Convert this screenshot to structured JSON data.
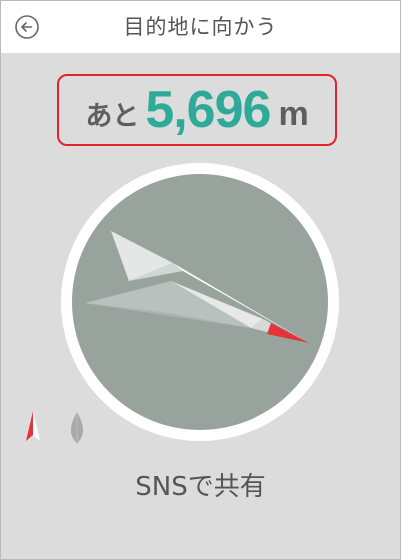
{
  "header": {
    "title": "目的地に向かう",
    "back_icon": "back-arrow-circle-icon"
  },
  "distance": {
    "prefix": "あと",
    "value": "5,696",
    "unit": "m",
    "value_color": "#2eab98",
    "highlight_color": "#e0232d"
  },
  "compass": {
    "dial_color": "#98a39e",
    "ring_color": "#ffffff",
    "pointer_tip_color": "#e3343a"
  },
  "legend": {
    "current_icon": "red-arrow-marker-icon",
    "other_icon": "gray-marker-icon"
  },
  "share": {
    "label": "SNSで共有"
  }
}
